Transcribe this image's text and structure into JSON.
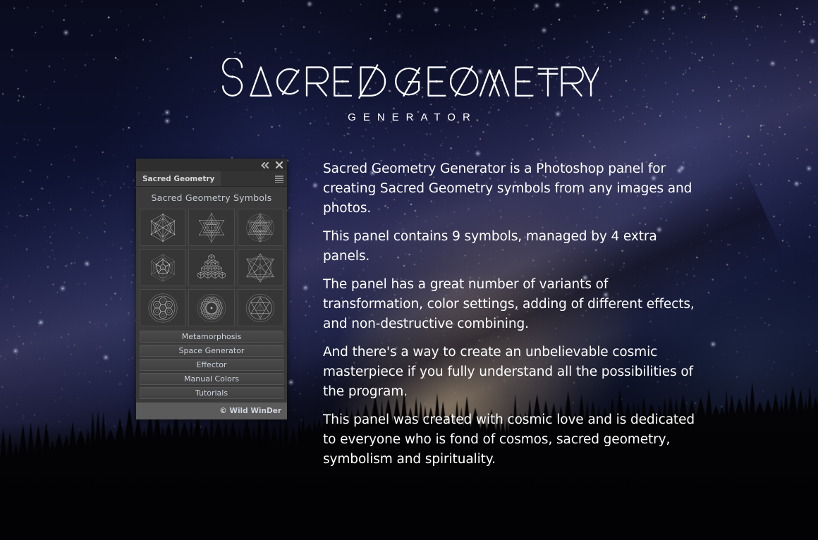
{
  "hero": {
    "title": "SACRED GEOMETRY",
    "subtitle": "GENERATOR"
  },
  "description": {
    "paragraphs": [
      "Sacred Geometry Generator is a Photoshop panel for creating Sacred Geometry symbols from any images and photos.",
      "This panel contains 9 symbols, managed by 4 extra panels.",
      "The panel has a great number of variants of transformation, color settings, adding of different effects, and non-destructive combining.",
      "And there's a way to create an unbelievable cosmic masterpiece if you fully understand all the possibilities of the program.",
      "This panel was created with cosmic love and is dedicated to everyone who is fond of cosmos, sacred geometry, symbolism and spirituality."
    ]
  },
  "panel": {
    "chrome": {
      "collapse_icon": "double-chevron-left-icon",
      "close_icon": "close-icon"
    },
    "tab": {
      "label": "Sacred Geometry",
      "menu_icon": "hamburger-menu-icon"
    },
    "section_title": "Sacred Geometry Symbols",
    "symbols": [
      {
        "name": "metatrons-cube",
        "label": "Metatron's Cube"
      },
      {
        "name": "sri-yantra-lattice",
        "label": "Sri Yantra Lattice"
      },
      {
        "name": "sri-yantra-circle",
        "label": "Sri Yantra"
      },
      {
        "name": "dodecahedron",
        "label": "Dodecahedron"
      },
      {
        "name": "cube-pyramid",
        "label": "Cube Pyramid"
      },
      {
        "name": "merkaba-star-tetrahedron",
        "label": "Merkaba"
      },
      {
        "name": "seed-of-life",
        "label": "Seed of Life"
      },
      {
        "name": "flower-rosette",
        "label": "Flower Rosette"
      },
      {
        "name": "star-of-david",
        "label": "Star of David"
      }
    ],
    "buttons": [
      "Metamorphosis",
      "Space Generator",
      "Effector",
      "Manual Colors",
      "Tutorials"
    ],
    "footer": "© Wild WinDer"
  },
  "colors": {
    "panel_bg": "#3a3a3a",
    "panel_chrome": "#2e2e2e",
    "panel_tab_active": "#3e3e3e",
    "panel_footer": "#5b5b5b",
    "text_light": "#ffffff",
    "text_panel": "#ccd2dc",
    "sky_deep": "#0a0d22",
    "sky_core": "#b9a188"
  }
}
